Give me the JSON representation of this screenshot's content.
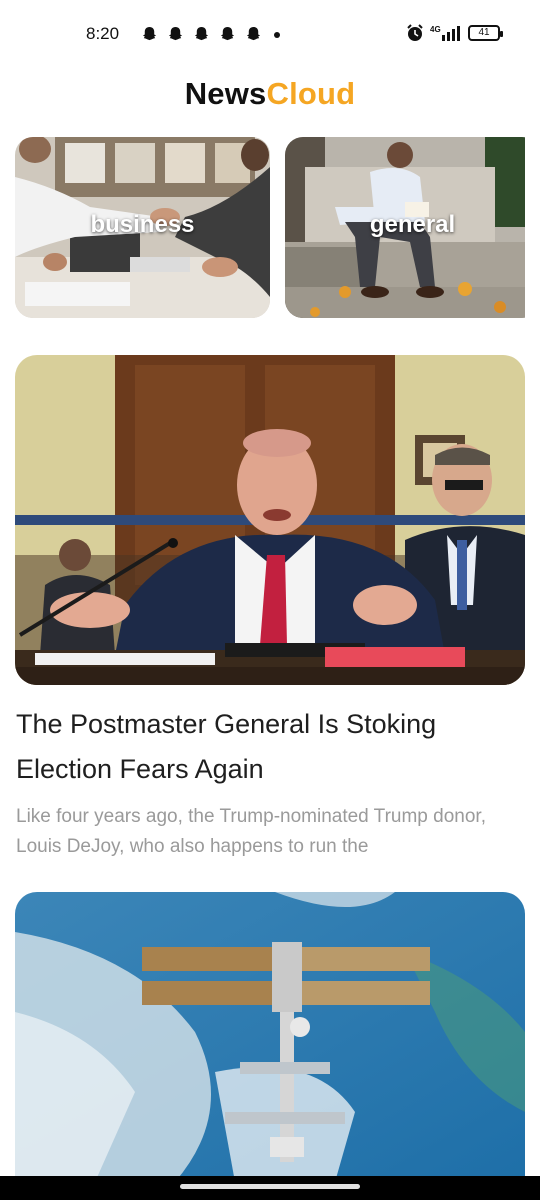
{
  "status_bar": {
    "time": "8:20",
    "notification_icons": [
      "snapchat-ghost-icon",
      "snapchat-ghost-icon",
      "snapchat-ghost-icon",
      "snapchat-ghost-icon",
      "snapchat-ghost-icon"
    ],
    "network": "4G",
    "battery": "41"
  },
  "app": {
    "title_part1": "News",
    "title_part2": "Cloud",
    "colors": {
      "title_dark": "#111111",
      "title_accent": "#f5a623"
    }
  },
  "categories": [
    {
      "label": "business",
      "image": "office-handshake-photo"
    },
    {
      "label": "general",
      "image": "man-reading-on-steps-photo"
    }
  ],
  "articles": [
    {
      "image": "postmaster-hearing-photo",
      "title": "The Postmaster General Is Stoking Election Fears Again",
      "description": "Like four years ago, the Trump-nominated Trump donor, Louis DeJoy, who also happens to run the"
    },
    {
      "image": "space-station-over-earth-photo"
    }
  ]
}
